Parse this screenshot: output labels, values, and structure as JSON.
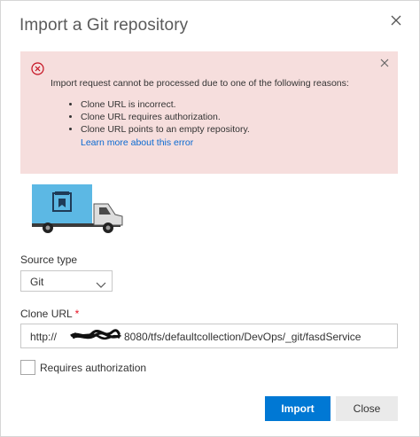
{
  "dialog": {
    "title": "Import a Git repository"
  },
  "error": {
    "message": "Import request cannot be processed due to one of the following reasons:",
    "reasons": [
      "Clone URL is incorrect.",
      "Clone URL requires authorization.",
      "Clone URL points to an empty repository."
    ],
    "link": "Learn more about this error"
  },
  "source_type": {
    "label": "Source type",
    "value": "Git"
  },
  "clone_url": {
    "label": "Clone URL",
    "required_marker": "*",
    "value_prefix": "http://",
    "value_suffix": "8080/tfs/defaultcollection/DevOps/_git/fasdService"
  },
  "auth": {
    "label": "Requires authorization"
  },
  "buttons": {
    "import": "Import",
    "close": "Close"
  },
  "colors": {
    "error_background": "#f6dedd",
    "error_icon": "#c50f1f",
    "primary_button": "#0078d4",
    "link": "#0a6ad2",
    "truck_body": "#5cb8e4"
  }
}
